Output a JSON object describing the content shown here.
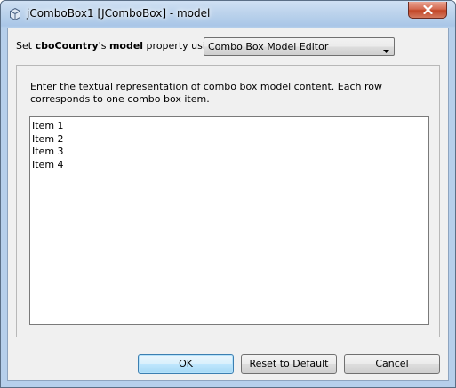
{
  "window": {
    "title": "jComboBox1 [JComboBox] - model"
  },
  "header": {
    "prefix": "Set ",
    "component_name": "cboCountry",
    "possessive": "'s ",
    "property_name": "model",
    "suffix": " property using:",
    "editor_selected": "Combo Box Model Editor"
  },
  "panel": {
    "instructions": "Enter the textual representation of combo box model content. Each row corresponds to one combo box item.",
    "items": [
      "Item 1",
      "Item 2",
      "Item 3",
      "Item 4"
    ]
  },
  "buttons": {
    "ok_label": "OK",
    "reset_label_before": "Reset to ",
    "reset_label_mnemonic": "D",
    "reset_label_after": "efault",
    "cancel_label": "Cancel"
  },
  "colors": {
    "titlebar": "#b6cfeb",
    "close_button": "#c24627",
    "dialog_background": "#f0f0f0",
    "default_button_border": "#3c7fb1"
  },
  "icons": {
    "window_icon": "cube-icon",
    "close_icon": "close-icon",
    "dropdown_icon": "chevron-down-icon"
  }
}
